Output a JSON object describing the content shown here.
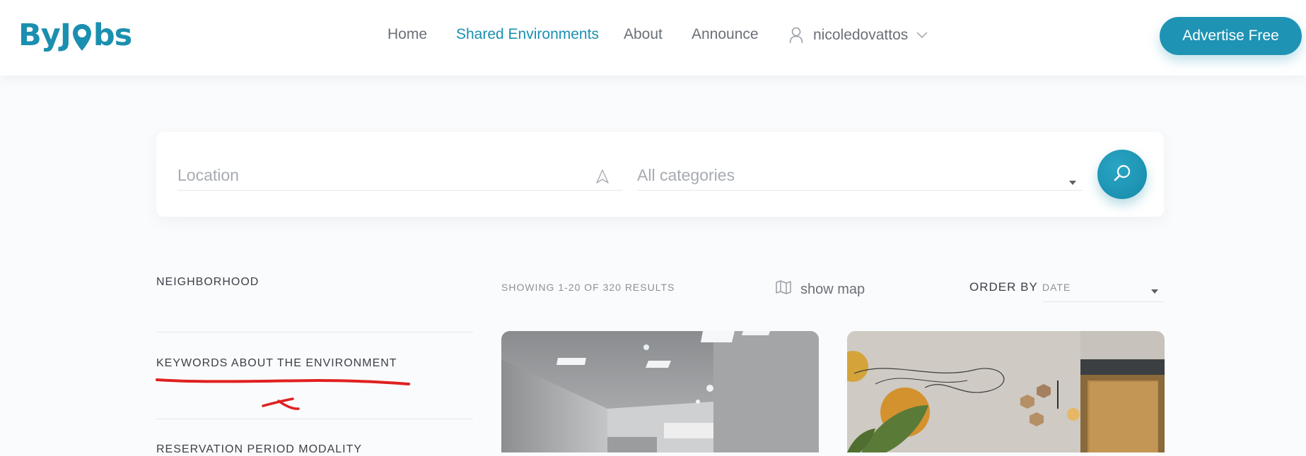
{
  "header": {
    "logo_text": "ByJobs",
    "nav": [
      {
        "label": "Home",
        "active": false
      },
      {
        "label": "Shared Environments",
        "active": true
      },
      {
        "label": "About",
        "active": false
      },
      {
        "label": "Announce",
        "active": false
      }
    ],
    "user": {
      "name": "nicoledovattos"
    },
    "advertise_label": "Advertise Free"
  },
  "search": {
    "location_placeholder": "Location",
    "category_value": "All categories"
  },
  "sidebar": {
    "filters": [
      {
        "title": "NEIGHBORHOOD"
      },
      {
        "title": "KEYWORDS ABOUT THE ENVIRONMENT"
      },
      {
        "title": "RESERVATION PERIOD MODALITY"
      }
    ]
  },
  "results": {
    "count_text": "SHOWING 1-20 OF 320 RESULTS",
    "show_map_label": "show map",
    "order_by_label": "ORDER BY",
    "order_by_value": "DATE"
  },
  "listings": [
    {
      "image": "empty-office-room-photo"
    },
    {
      "image": "decorated-wall-room-photo"
    }
  ],
  "colors": {
    "brand": "#1b8fb0",
    "button": "#1f93b3",
    "annotation": "#e02020"
  }
}
